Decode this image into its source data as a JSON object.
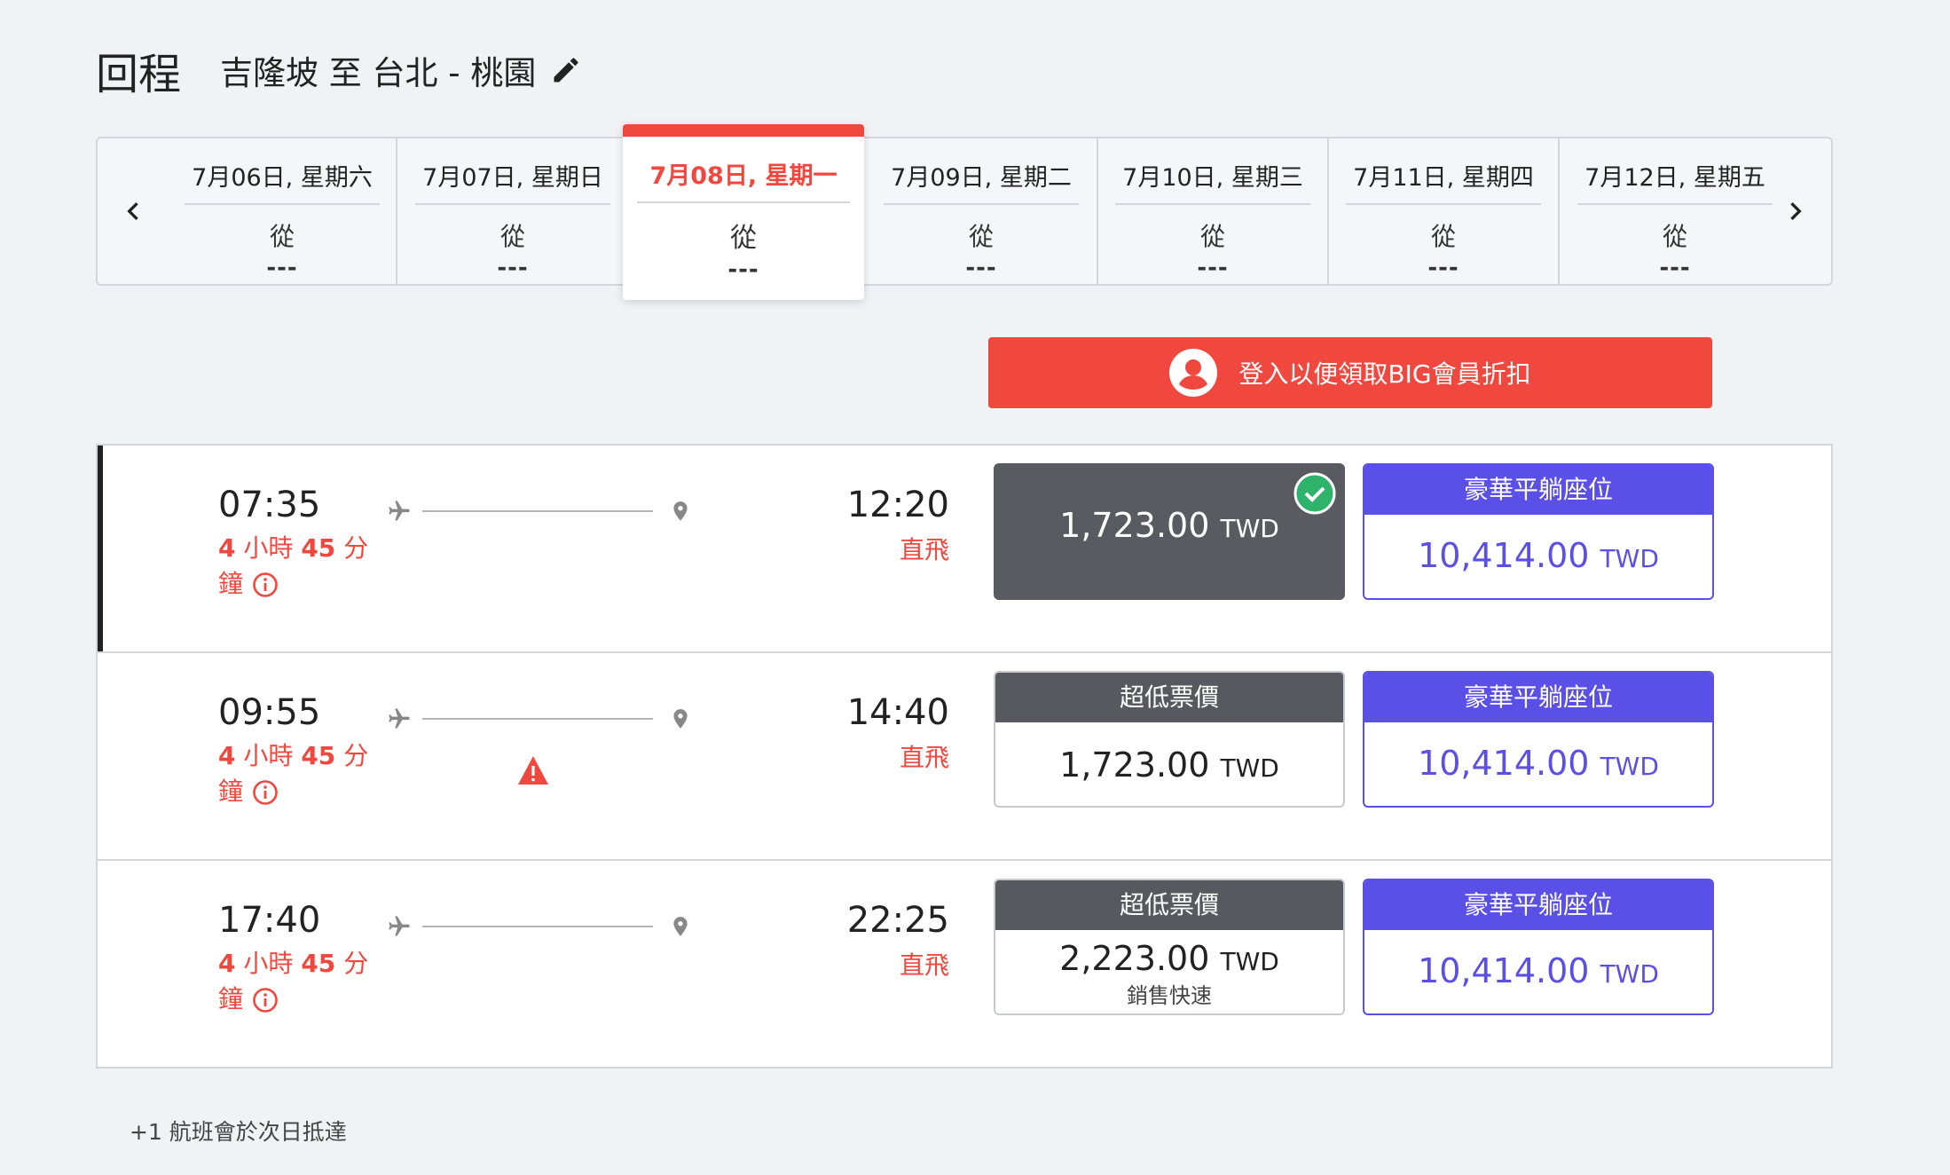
{
  "header": {
    "title": "回程",
    "route": "吉隆坡 至 台北 - 桃園"
  },
  "dates": [
    {
      "label": "7月06日, 星期六",
      "from": "從",
      "price": "---"
    },
    {
      "label": "7月07日, 星期日",
      "from": "從",
      "price": "---"
    },
    {
      "label": "7月08日, 星期一",
      "from": "從",
      "price": "---"
    },
    {
      "label": "7月09日, 星期二",
      "from": "從",
      "price": "---"
    },
    {
      "label": "7月10日, 星期三",
      "from": "從",
      "price": "---"
    },
    {
      "label": "7月11日, 星期四",
      "from": "從",
      "price": "---"
    },
    {
      "label": "7月12日, 星期五",
      "from": "從",
      "price": "---"
    }
  ],
  "selected_date_index": 2,
  "login_banner": {
    "label": "登入以便領取BIG會員折扣"
  },
  "flights": [
    {
      "depart": "07:35",
      "duration_hours": "4",
      "duration_minutes": "45",
      "duration_text_1": "小時",
      "duration_text_2": "分",
      "duration_text_3": "鐘",
      "arrive": "12:20",
      "stops": "直飛",
      "economy": {
        "header": "",
        "amount": "1,723.00",
        "currency": "TWD",
        "note": "",
        "selected": true
      },
      "premium": {
        "header": "豪華平躺座位",
        "amount": "10,414.00",
        "currency": "TWD"
      }
    },
    {
      "depart": "09:55",
      "duration_hours": "4",
      "duration_minutes": "45",
      "duration_text_1": "小時",
      "duration_text_2": "分",
      "duration_text_3": "鐘",
      "arrive": "14:40",
      "stops": "直飛",
      "warning": true,
      "economy": {
        "header": "超低票價",
        "amount": "1,723.00",
        "currency": "TWD",
        "note": ""
      },
      "premium": {
        "header": "豪華平躺座位",
        "amount": "10,414.00",
        "currency": "TWD"
      }
    },
    {
      "depart": "17:40",
      "duration_hours": "4",
      "duration_minutes": "45",
      "duration_text_1": "小時",
      "duration_text_2": "分",
      "duration_text_3": "鐘",
      "arrive": "22:25",
      "stops": "直飛",
      "economy": {
        "header": "超低票價",
        "amount": "2,223.00",
        "currency": "TWD",
        "note": "銷售快速"
      },
      "premium": {
        "header": "豪華平躺座位",
        "amount": "10,414.00",
        "currency": "TWD"
      }
    }
  ],
  "footnote": "+1 航班會於次日抵達",
  "colors": {
    "accent_red": "#f0483e",
    "premium_purple": "#5a4fe6",
    "economy_gray": "#58595f",
    "check_green": "#2fb36b"
  },
  "icons": [
    "pencil-icon",
    "chevron-left-icon",
    "chevron-right-icon",
    "user-avatar-icon",
    "info-icon",
    "plane-icon",
    "location-pin-icon",
    "warning-icon",
    "check-icon"
  ]
}
